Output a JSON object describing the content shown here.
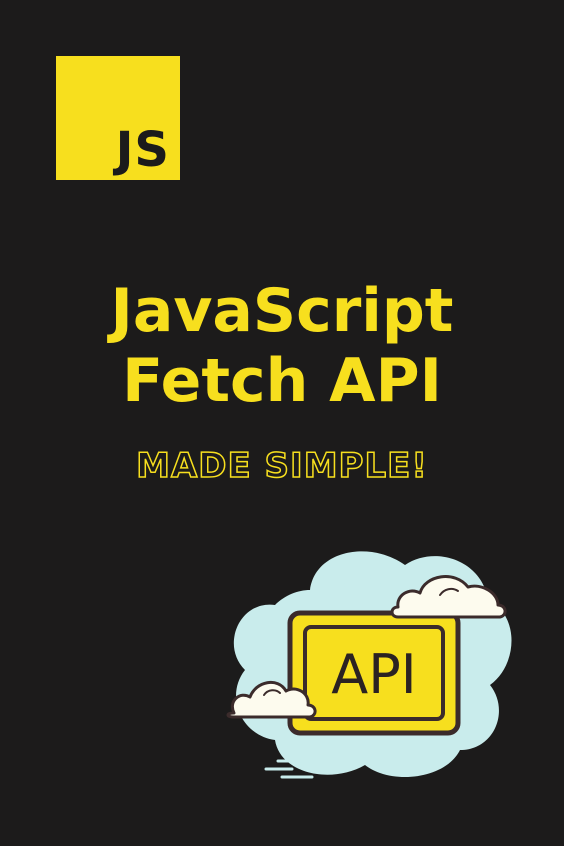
{
  "logo": {
    "text": "JS",
    "background": "#f7df1e",
    "text_color": "#1c1b1b"
  },
  "title": {
    "line1": "JavaScript",
    "line2": "Fetch API",
    "color": "#f7df1e"
  },
  "subtitle": {
    "text": "MADE SIMPLE!",
    "style": "yellow outline"
  },
  "illustration": {
    "label": "API",
    "icons": [
      "cloud-icon",
      "api-board-icon"
    ],
    "colors": {
      "cloud": "#c9ecec",
      "board": "#f7df1e",
      "outline": "#3b2b2b"
    }
  },
  "background_color": "#1c1b1b"
}
